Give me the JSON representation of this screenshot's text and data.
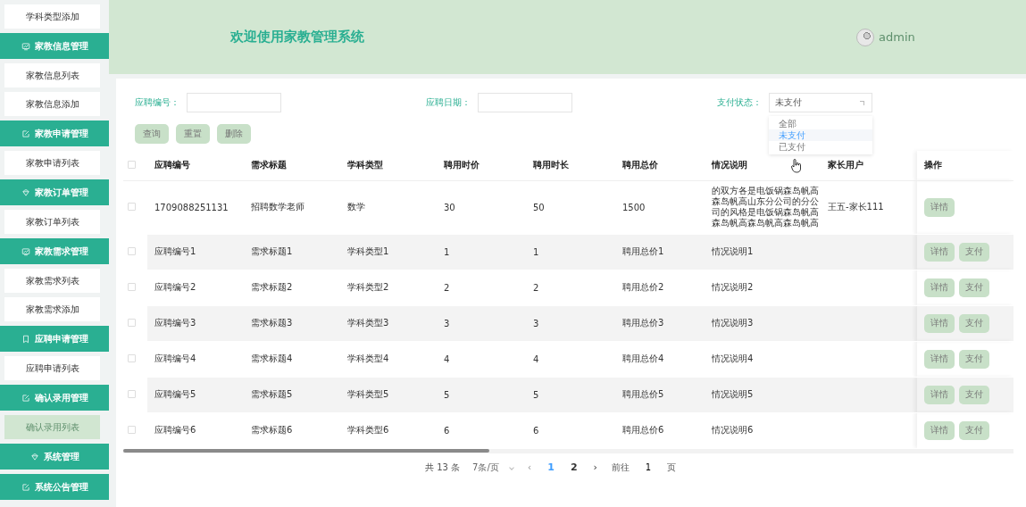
{
  "sidebar": {
    "items": [
      {
        "kind": "link",
        "label": "学科类型添加",
        "selected": false
      },
      {
        "kind": "header",
        "label": "家教信息管理"
      },
      {
        "kind": "link",
        "label": "家教信息列表",
        "selected": false
      },
      {
        "kind": "link",
        "label": "家教信息添加",
        "selected": false
      },
      {
        "kind": "header",
        "label": "家教申请管理"
      },
      {
        "kind": "link",
        "label": "家教申请列表",
        "selected": false
      },
      {
        "kind": "header",
        "label": "家教订单管理"
      },
      {
        "kind": "link",
        "label": "家教订单列表",
        "selected": false
      },
      {
        "kind": "header",
        "label": "家教需求管理"
      },
      {
        "kind": "link",
        "label": "家教需求列表",
        "selected": false
      },
      {
        "kind": "link",
        "label": "家教需求添加",
        "selected": false
      },
      {
        "kind": "header",
        "label": "应聘申请管理"
      },
      {
        "kind": "link",
        "label": "应聘申请列表",
        "selected": false
      },
      {
        "kind": "header",
        "label": "确认录用管理"
      },
      {
        "kind": "link",
        "label": "确认录用列表",
        "selected": true
      },
      {
        "kind": "header",
        "label": "系统管理"
      },
      {
        "kind": "header",
        "label": "系统公告管理"
      }
    ]
  },
  "header": {
    "title": "欢迎使用家教管理系统",
    "user": "admin"
  },
  "search": {
    "fields": [
      {
        "kind": "input",
        "label": "应聘编号："
      },
      {
        "kind": "input",
        "label": "应聘日期："
      },
      {
        "kind": "select",
        "label": "支付状态：",
        "value": "未支付",
        "options": [
          {
            "label": "全部",
            "selected": false
          },
          {
            "label": "未支付",
            "selected": true
          },
          {
            "label": "已支付",
            "selected": false
          }
        ]
      }
    ],
    "buttons": [
      "查询",
      "重置",
      "删除"
    ]
  },
  "table": {
    "all_checked": false,
    "columns": [
      "应聘编号",
      "需求标题",
      "学科类型",
      "聘用时价",
      "聘用时长",
      "聘用总价",
      "情况说明",
      "家长用户",
      "操作"
    ],
    "rows": [
      {
        "checked": false,
        "cells": [
          "1709088251131",
          "招聘数学老师",
          "数学",
          "30",
          "50",
          "1500",
          "的双方各是电饭锅森岛帆高森岛帆高山东分公司的分公司的风格是电饭锅森岛帆高森岛帆高森岛帆高森岛帆高",
          "王五-家长111"
        ],
        "actions": [
          "详情"
        ]
      },
      {
        "checked": false,
        "cells": [
          "应聘编号1",
          "需求标题1",
          "学科类型1",
          "1",
          "1",
          "聘用总价1",
          "情况说明1",
          ""
        ],
        "actions": [
          "详情",
          "支付"
        ]
      },
      {
        "checked": false,
        "cells": [
          "应聘编号2",
          "需求标题2",
          "学科类型2",
          "2",
          "2",
          "聘用总价2",
          "情况说明2",
          ""
        ],
        "actions": [
          "详情",
          "支付"
        ]
      },
      {
        "checked": false,
        "cells": [
          "应聘编号3",
          "需求标题3",
          "学科类型3",
          "3",
          "3",
          "聘用总价3",
          "情况说明3",
          ""
        ],
        "actions": [
          "详情",
          "支付"
        ]
      },
      {
        "checked": false,
        "cells": [
          "应聘编号4",
          "需求标题4",
          "学科类型4",
          "4",
          "4",
          "聘用总价4",
          "情况说明4",
          ""
        ],
        "actions": [
          "详情",
          "支付"
        ]
      },
      {
        "checked": false,
        "cells": [
          "应聘编号5",
          "需求标题5",
          "学科类型5",
          "5",
          "5",
          "聘用总价5",
          "情况说明5",
          ""
        ],
        "actions": [
          "详情",
          "支付"
        ]
      },
      {
        "checked": false,
        "cells": [
          "应聘编号6",
          "需求标题6",
          "学科类型6",
          "6",
          "6",
          "聘用总价6",
          "情况说明6",
          ""
        ],
        "actions": [
          "详情",
          "支付"
        ]
      }
    ]
  },
  "pagination": {
    "total": "共 13 条",
    "page_size": "7条/页",
    "prev": "‹",
    "pages": [
      {
        "label": "1",
        "selected": true
      },
      {
        "label": "2",
        "selected": false
      }
    ],
    "next": "›",
    "goto_label": "前往",
    "goto_value": "1",
    "goto_suffix": "页"
  }
}
